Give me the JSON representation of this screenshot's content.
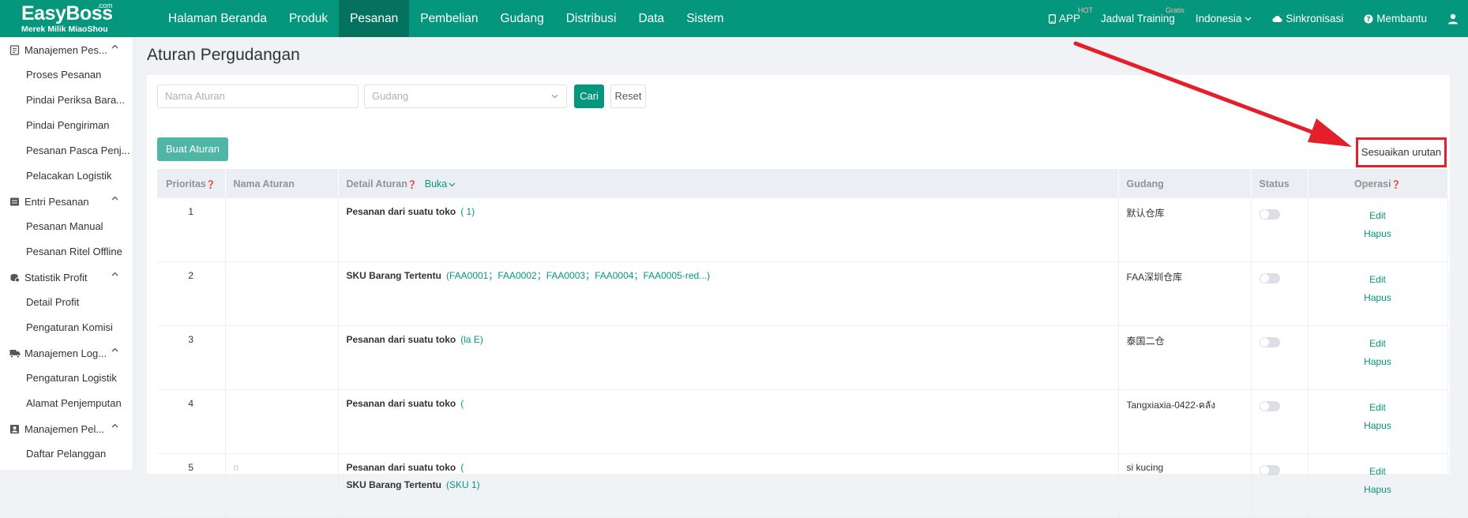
{
  "logo": {
    "brand": "EasyBoss",
    "com": ".com",
    "sub": "Merek Milik MiaoShou"
  },
  "nav": [
    "Halaman Beranda",
    "Produk",
    "Pesanan",
    "Pembelian",
    "Gudang",
    "Distribusi",
    "Data",
    "Sistem"
  ],
  "nav_active": 2,
  "topright": {
    "app": "APP",
    "app_badge": "HOT",
    "training": "Jadwal Training",
    "training_badge": "Gratis",
    "language": "Indonesia",
    "sync": "Sinkronisasi",
    "help": "Membantu"
  },
  "sidebar": {
    "groups": [
      {
        "label": "Manajemen Pes...",
        "icon": "order-icon",
        "items": [
          "Proses Pesanan",
          "Pindai Periksa Bara...",
          "Pindai Pengiriman",
          "Pesanan Pasca Penj...",
          "Pelacakan Logistik"
        ]
      },
      {
        "label": "Entri Pesanan",
        "icon": "list-icon",
        "items": [
          "Pesanan Manual",
          "Pesanan Ritel Offline"
        ]
      },
      {
        "label": "Statistik Profit",
        "icon": "coin-icon",
        "items": [
          "Detail Profit",
          "Pengaturan Komisi"
        ]
      },
      {
        "label": "Manajemen Log...",
        "icon": "truck-icon",
        "items": [
          "Pengaturan Logistik",
          "Alamat Penjemputan"
        ]
      },
      {
        "label": "Manajemen Pel...",
        "icon": "customer-icon",
        "items": [
          "Daftar Pelanggan"
        ]
      }
    ]
  },
  "page": {
    "title": "Aturan Pergudangan"
  },
  "filter": {
    "name_placeholder": "Nama Aturan",
    "warehouse_placeholder": "Gudang",
    "search_label": "Cari",
    "reset_label": "Reset"
  },
  "actions": {
    "create_label": "Buat Aturan",
    "sort_label": "Sesuaikan urutan"
  },
  "table": {
    "headers": {
      "priority": "Prioritas",
      "name": "Nama Aturan",
      "detail": "Detail Aturan",
      "expand": "Buka",
      "warehouse": "Gudang",
      "status": "Status",
      "operation": "Operasi"
    },
    "rows": [
      {
        "priority": "1",
        "name": "",
        "details": [
          {
            "label": "Pesanan dari suatu toko",
            "value": "(                  1)"
          }
        ],
        "warehouse": "默认仓库",
        "status_on": false
      },
      {
        "priority": "2",
        "name": "",
        "details": [
          {
            "label": "SKU Barang Tertentu",
            "value": "(FAA0001；FAA0002；FAA0003；FAA0004；FAA0005-red...)"
          }
        ],
        "warehouse": "FAA深圳仓库",
        "status_on": false
      },
      {
        "priority": "3",
        "name": "",
        "details": [
          {
            "label": "Pesanan dari suatu toko",
            "value": "(la                                             E)"
          }
        ],
        "warehouse": "泰国二仓",
        "status_on": false
      },
      {
        "priority": "4",
        "name": "",
        "details": [
          {
            "label": "Pesanan dari suatu toko",
            "value": "("
          }
        ],
        "warehouse": "Tangxiaxia-0422-คลัง",
        "status_on": false
      },
      {
        "priority": "5",
        "name": "n",
        "details": [
          {
            "label": "Pesanan dari suatu toko",
            "value": "("
          },
          {
            "label": "SKU Barang Tertentu",
            "value": "(SKU                 1)"
          }
        ],
        "warehouse": "si kucing",
        "status_on": false
      }
    ],
    "edit_label": "Edit",
    "delete_label": "Hapus"
  },
  "colors": {
    "primary": "#04977e",
    "annotation": "#e3202a"
  }
}
